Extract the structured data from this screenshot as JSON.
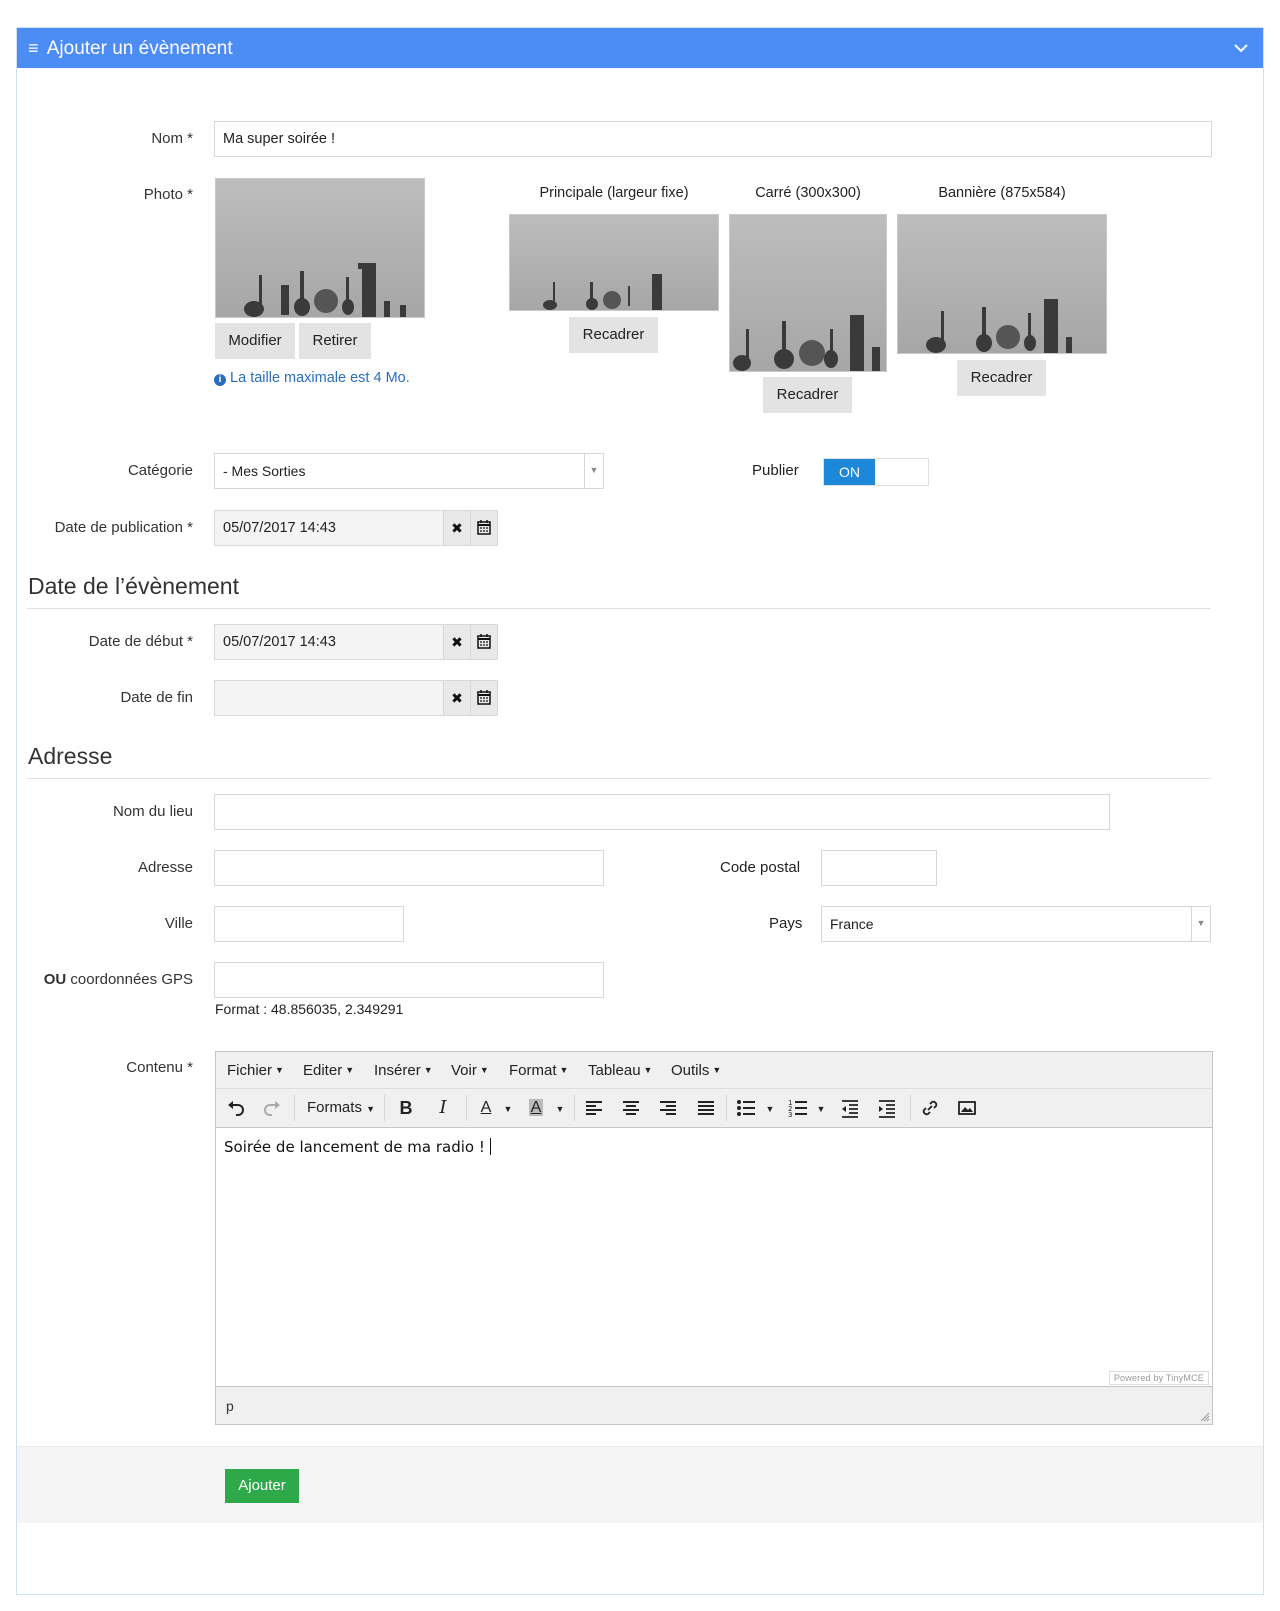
{
  "header": {
    "title": "Ajouter un évènement",
    "menu_glyph": "≡",
    "chevron": "chevron-down-icon"
  },
  "form": {
    "nom": {
      "label": "Nom *",
      "value": "Ma super soirée !"
    },
    "photo": {
      "label": "Photo *",
      "modify_label": "Modifier",
      "remove_label": "Retirer",
      "info": "La taille maximale est 4 Mo.",
      "crops": [
        {
          "caption": "Principale (largeur fixe)",
          "button": "Recadrer"
        },
        {
          "caption": "Carré (300x300)",
          "button": "Recadrer"
        },
        {
          "caption": "Bannière (875x584)",
          "button": "Recadrer"
        }
      ]
    },
    "categorie": {
      "label": "Catégorie",
      "value": "- Mes Sorties"
    },
    "publier": {
      "label": "Publier",
      "toggle_label": "ON",
      "state": true
    },
    "date_publication": {
      "label": "Date de publication *",
      "value": "05/07/2017 14:43"
    }
  },
  "event_dates": {
    "title": "Date de l’évènement",
    "debut": {
      "label": "Date de début *",
      "value": "05/07/2017 14:43"
    },
    "fin": {
      "label": "Date de fin",
      "value": ""
    }
  },
  "address": {
    "title": "Adresse",
    "lieu": {
      "label": "Nom du lieu",
      "value": ""
    },
    "adresse": {
      "label": "Adresse",
      "value": ""
    },
    "code_postal": {
      "label": "Code postal",
      "value": ""
    },
    "ville": {
      "label": "Ville",
      "value": ""
    },
    "pays": {
      "label": "Pays",
      "value": "France"
    },
    "gps": {
      "label_bold": "OU",
      "label_rest": " coordonnées GPS",
      "value": "",
      "format_hint": "Format : 48.856035, 2.349291"
    }
  },
  "content": {
    "label": "Contenu *",
    "menus": [
      "Fichier",
      "Editer",
      "Insérer",
      "Voir",
      "Format",
      "Tableau",
      "Outils"
    ],
    "formats_label": "Formats",
    "body_text": "Soirée de lancement de ma radio !",
    "powered": "Powered by TinyMCE",
    "path": "p"
  },
  "footer": {
    "submit_label": "Ajouter"
  },
  "colors": {
    "header": "#4b8cf5",
    "toggle_on": "#1e88d8",
    "submit": "#2ea94a",
    "info": "#2a6ebb"
  }
}
